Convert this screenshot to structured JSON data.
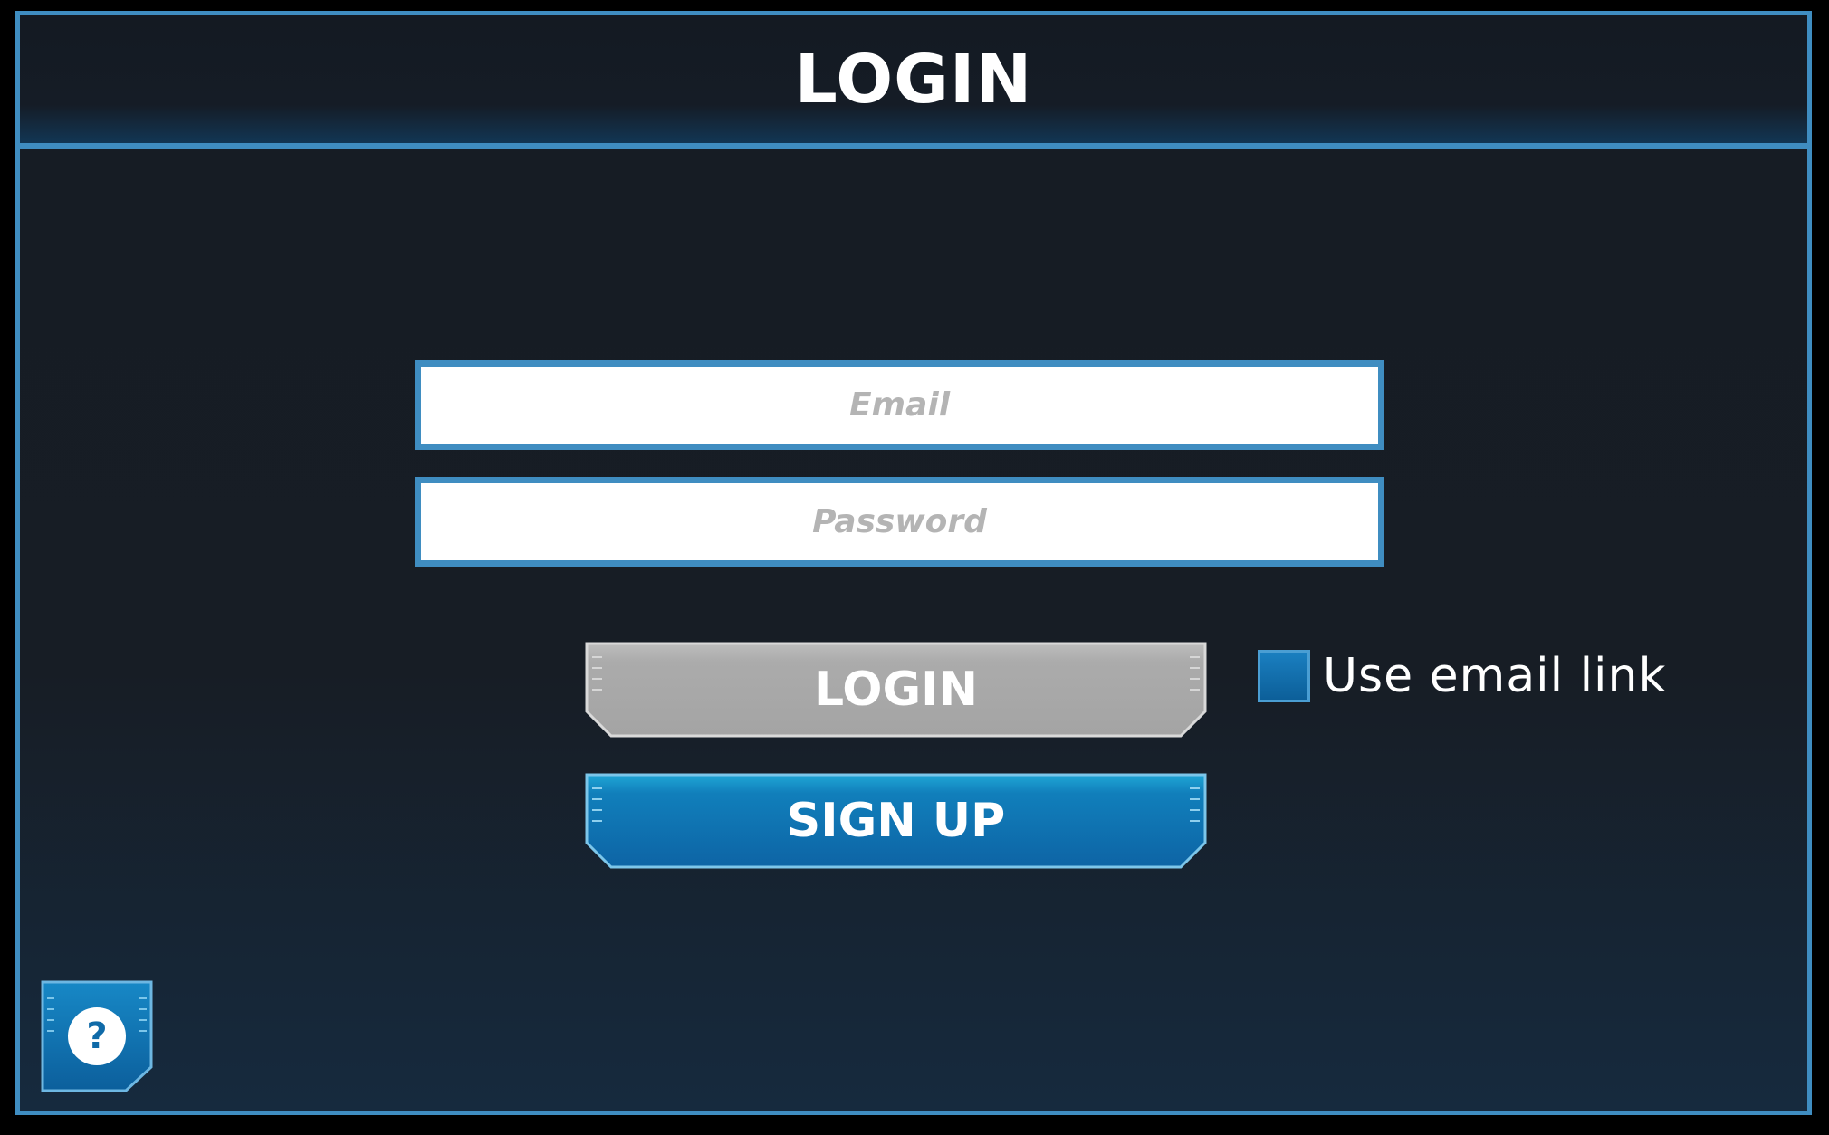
{
  "header": {
    "title": "LOGIN"
  },
  "form": {
    "email_placeholder": "Email",
    "email_value": "",
    "password_placeholder": "Password",
    "password_value": ""
  },
  "buttons": {
    "login_label": "LOGIN",
    "signup_label": "SIGN UP"
  },
  "options": {
    "email_link_label": "Use email link",
    "email_link_checked": false
  },
  "help": {
    "icon": "question-mark-icon",
    "glyph": "?"
  },
  "colors": {
    "accent": "#3f8dc1",
    "background": "#171d25",
    "login_button": "#a8a8a8",
    "signup_button": "#0f6aa8"
  }
}
